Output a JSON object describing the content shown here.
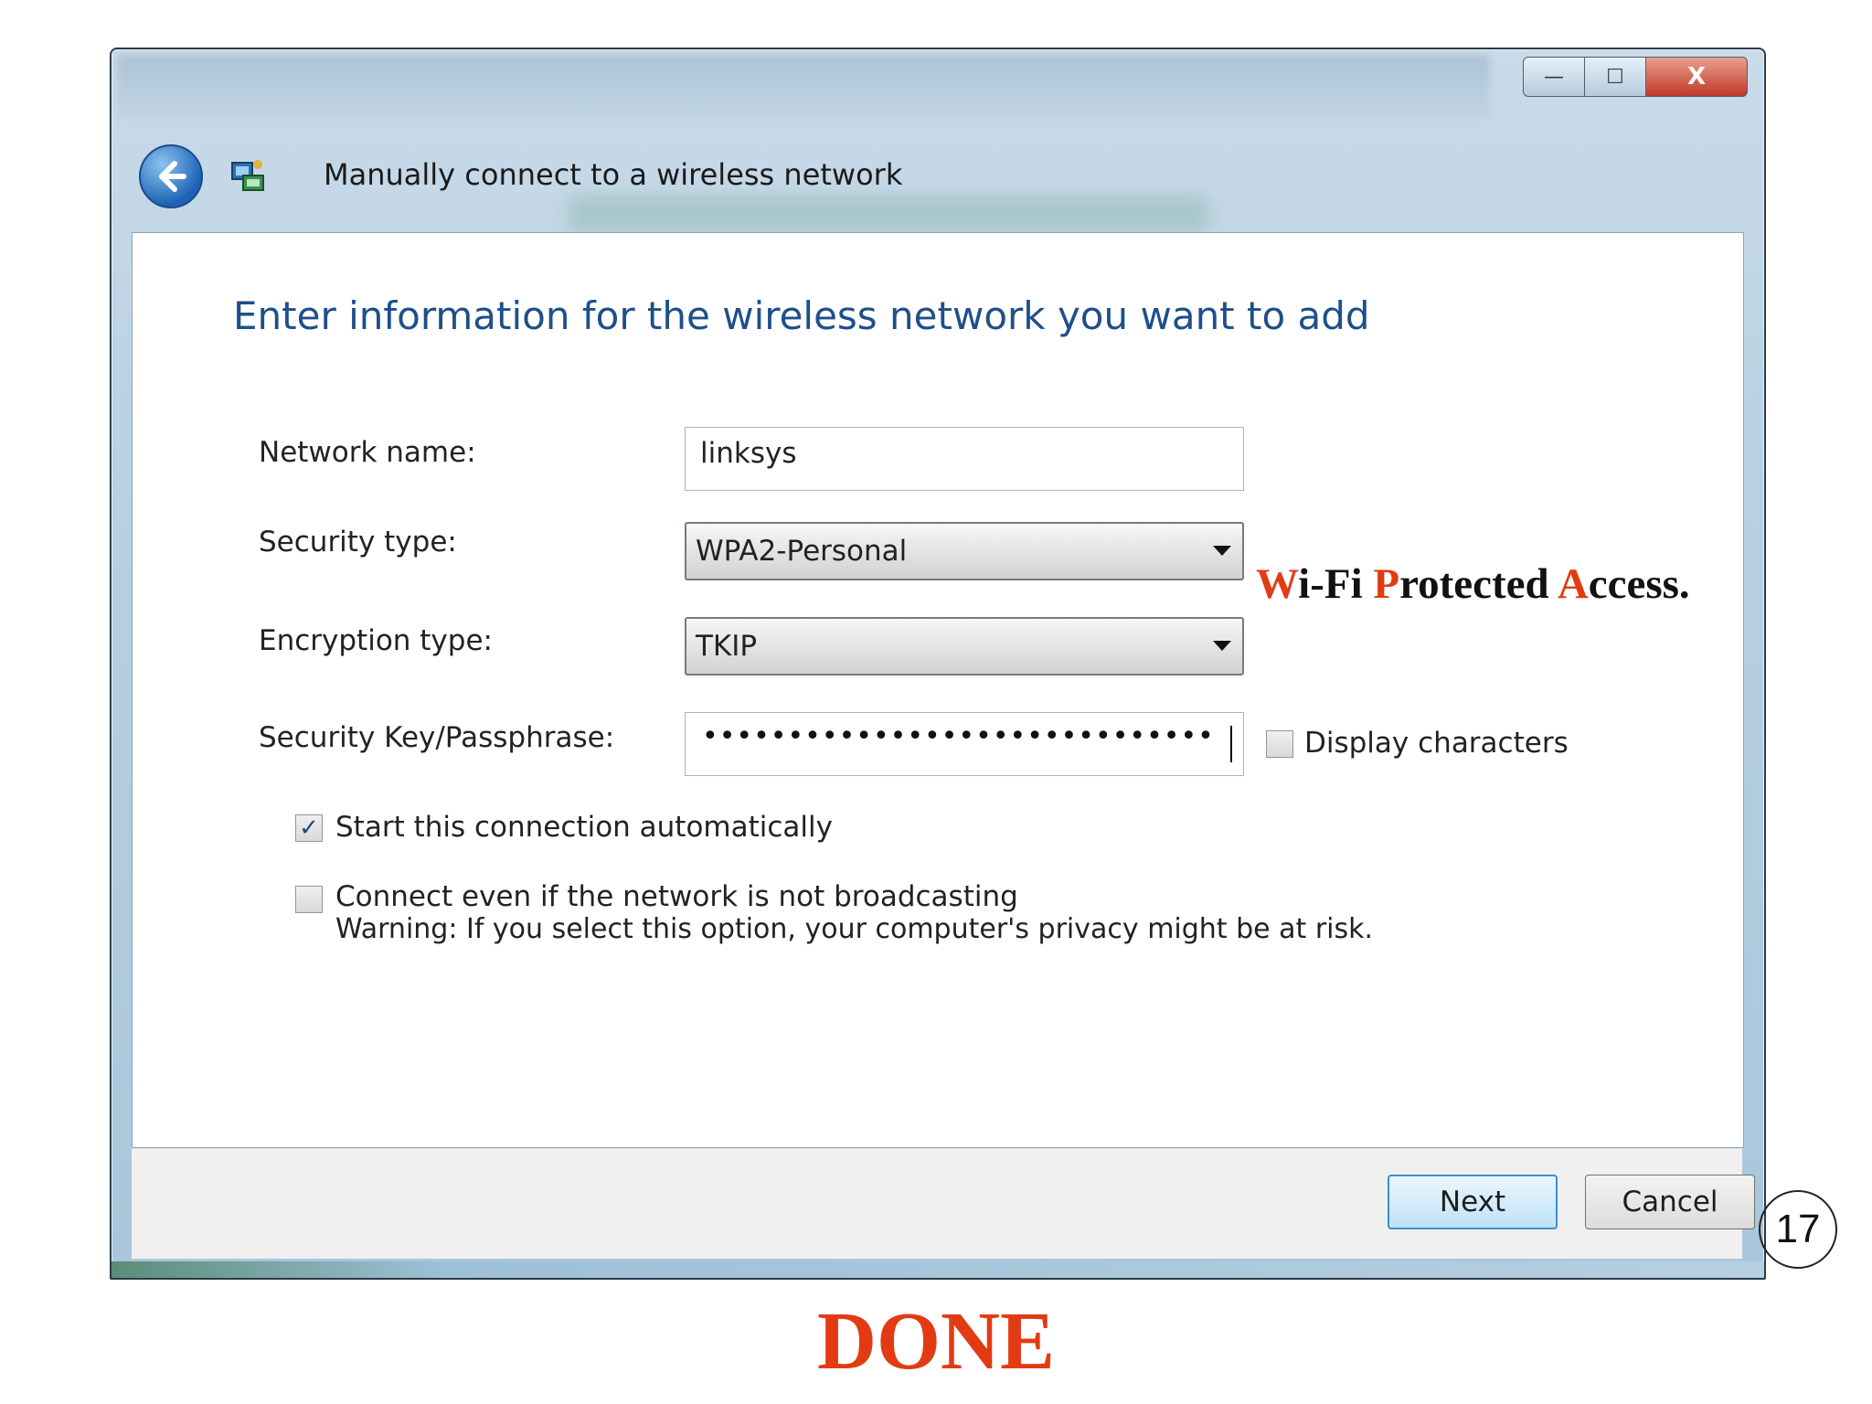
{
  "window": {
    "title": "Manually connect to a wireless network",
    "caption_buttons": {
      "minimize": "—",
      "maximize": "☐",
      "close": "X"
    }
  },
  "heading": "Enter information for the wireless network you want to add",
  "form": {
    "network_name_label": "Network name:",
    "network_name_value": "linksys",
    "security_type_label": "Security type:",
    "security_type_value": "WPA2-Personal",
    "encryption_type_label": "Encryption type:",
    "encryption_type_value": "TKIP",
    "passphrase_label": "Security Key/Passphrase:",
    "passphrase_mask": "••••••••••••••••••••••••••••••",
    "display_characters_label": "Display characters",
    "display_characters_checked": false,
    "start_automatically_label": "Start this connection automatically",
    "start_automatically_checked": true,
    "connect_not_broadcasting_label": "Connect even if the network is not broadcasting",
    "connect_not_broadcasting_checked": false,
    "warning": "Warning: If you select this option, your computer's privacy might be at risk."
  },
  "footer": {
    "next_label": "Next",
    "cancel_label": "Cancel"
  },
  "annotation": {
    "w": "W",
    "w_rest": "i-Fi ",
    "p": "P",
    "p_rest": "rotected ",
    "a": "A",
    "a_rest": "ccess."
  },
  "page_number": "17",
  "done_label": "DONE",
  "colors": {
    "accent_red": "#e23b14",
    "heading_blue": "#1e4f8a"
  }
}
